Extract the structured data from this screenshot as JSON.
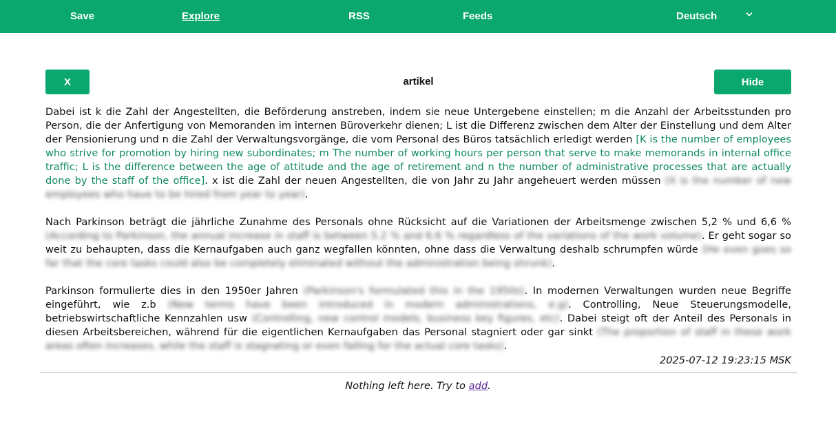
{
  "nav": {
    "save": "Save",
    "explore": "Explore",
    "rss": "RSS",
    "feeds": "Feeds",
    "language": "Deutsch"
  },
  "toolbar": {
    "close_label": "X",
    "title": "artikel",
    "hide_label": "Hide"
  },
  "article": {
    "p1_a": "Dabei ist k die Zahl der Angestellten, die Beförderung anstreben, indem sie neue Untergebene einstellen; m die Anzahl der Arbeitsstunden pro Person, die der Anfertigung von Memoranden im internen Büroverkehr dienen; L ist die Differenz zwischen dem Alter der Einstellung und dem Alter der Pensionierung und n die Zahl der Verwaltungsvorgänge, die vom Personal des Büros tatsächlich erledigt werden",
    "p1_a_tr": "[K is the number of employees who strive for promotion by hiring new subordinates; m The number of working hours per person that serve to make memorands in internal office traffic; L is the difference between the age of attitude and the age of retirement and n the number of administrative processes that are actually done by the staff of the office]",
    "p1_b": ". x ist die Zahl der neuen Angestellten, die von Jahr zu Jahr angeheuert werden müssen",
    "p1_b_tr": "(X is the number of new employees who have to be hired from year to year)",
    "p1_end": ".",
    "p2_a": "Nach Parkinson beträgt die jährliche Zunahme des Personals ohne Rücksicht auf die Variationen der Arbeitsmenge zwischen 5,2 % und 6,6 %",
    "p2_a_tr": "(According to Parkinson, the annual increase in staff is between 5.2 % and 6.6 % regardless of the variations of the work volume)",
    "p2_b": ". Er geht sogar so weit zu behaupten, dass die Kernaufgaben auch ganz wegfallen könnten, ohne dass die Verwaltung deshalb schrumpfen würde",
    "p2_b_tr": "(He even goes so far that the core tasks could also be completely eliminated without the administration being shrunk)",
    "p2_end": ".",
    "p3_a": "Parkinson formulierte dies in den 1950er Jahren",
    "p3_a_tr": "(Parkinson's formulated this in the 1950s)",
    "p3_b": ". In modernen Verwaltungen wurden neue Begriffe eingeführt, wie z.b",
    "p3_b_tr": "(New terms have been introduced in modern administrations, e.g)",
    "p3_c": ". Controlling, Neue Steuerungsmodelle, betriebswirtschaftliche Kennzahlen usw",
    "p3_c_tr": "(Controlling, new control models, business key figures, etc)",
    "p3_d": ". Dabei steigt oft der Anteil des Personals in diesen Arbeitsbereichen, während für die eigentlichen Kernaufgaben das Personal stagniert oder gar sinkt",
    "p3_d_tr": "(The proportion of staff in these work areas often increases, while the staff is stagnating or even falling for the actual core tasks)",
    "p3_end": "."
  },
  "timestamp": "2025-07-12 19:23:15 MSK",
  "footer": {
    "text": "Nothing left here. Try to ",
    "link": "add",
    "end": "."
  },
  "colors": {
    "brand_green": "#0aa86e",
    "translation_green": "#0f8a5f",
    "link_purple": "#5a2a9a"
  },
  "icons": {
    "language_dropdown": "chevron-down-icon"
  }
}
